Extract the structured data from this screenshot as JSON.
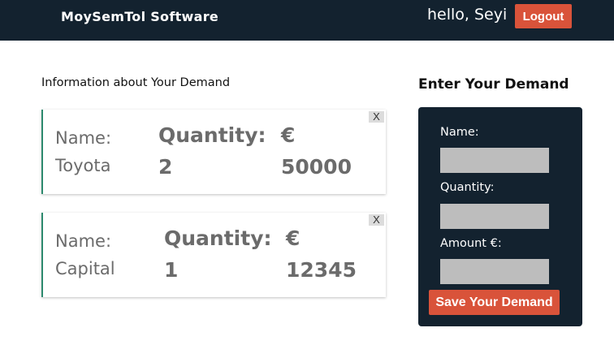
{
  "header": {
    "brand": "MoySemTol Software",
    "greeting": "hello, Seyi",
    "logout_label": "Logout"
  },
  "demands": {
    "title": "Information about Your Demand",
    "items": [
      {
        "name_label": "Name:",
        "name": "Toyota",
        "quantity_label": "Quantity:",
        "quantity": "2",
        "currency": "€",
        "amount": "50000",
        "close": "X"
      },
      {
        "name_label": "Name:",
        "name": "Capital",
        "quantity_label": "Quantity:",
        "quantity": "1",
        "currency": "€",
        "amount": "12345",
        "close": "X"
      }
    ]
  },
  "form": {
    "title": "Enter Your Demand",
    "name_label": "Name:",
    "quantity_label": "Quantity:",
    "amount_label": "Amount €:",
    "name_value": "",
    "quantity_value": "",
    "amount_value": "",
    "save_label": "Save Your Demand"
  },
  "colors": {
    "header_bg": "#13222f",
    "accent": "#d9533a",
    "card_border": "#2d8a6e"
  }
}
